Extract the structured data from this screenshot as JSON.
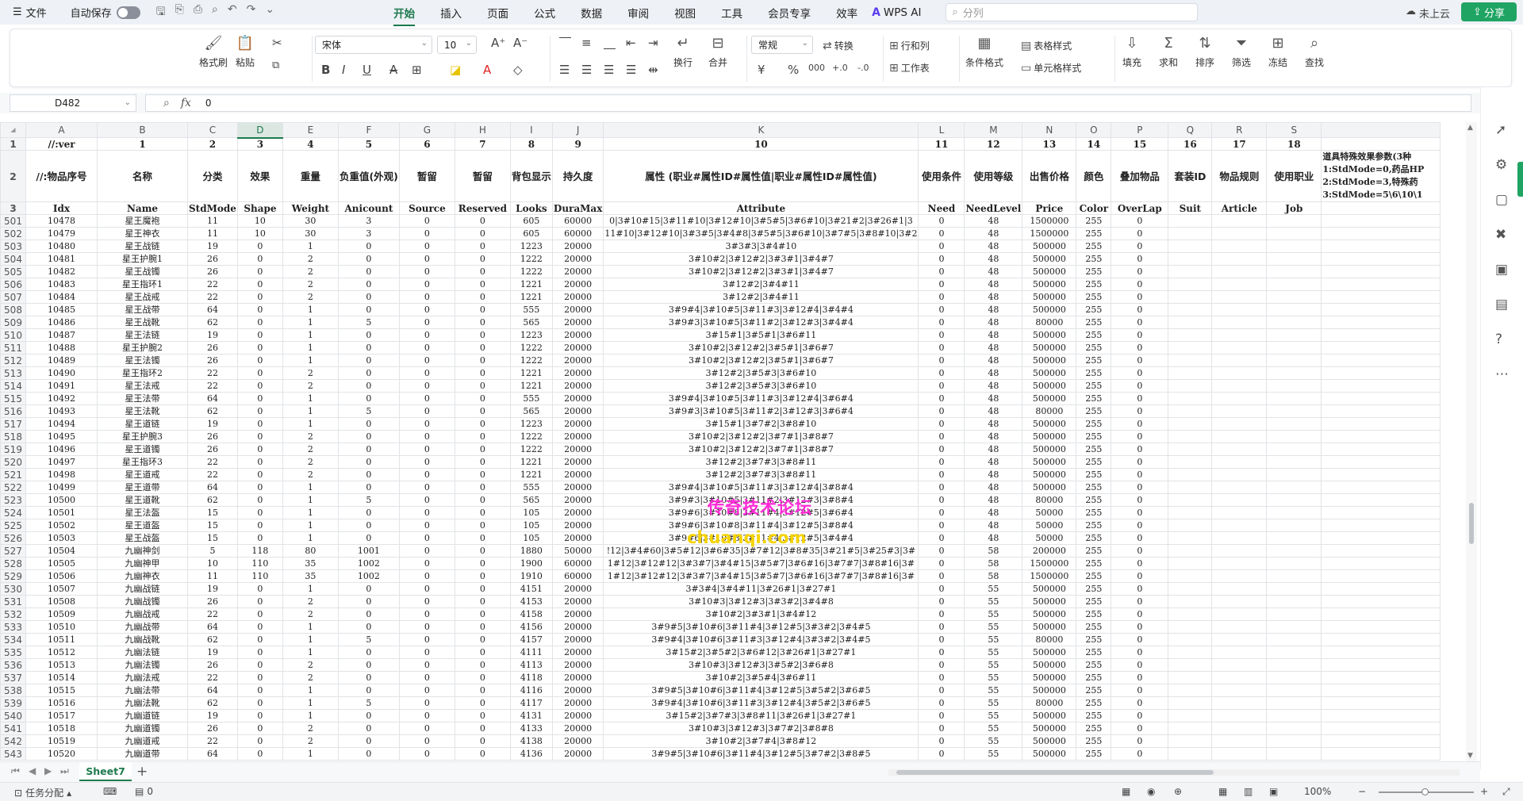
{
  "menu": {
    "file": "文件",
    "autosave": "自动保存",
    "tabs": [
      "开始",
      "插入",
      "页面",
      "公式",
      "数据",
      "审阅",
      "视图",
      "工具",
      "会员专享",
      "效率"
    ],
    "wps_ai": "WPS AI",
    "search_placeholder": "分列",
    "cloud": "未上云",
    "share": "分享"
  },
  "ribbon": {
    "format_painter": "格式刷",
    "paste": "粘贴",
    "font_name": "宋体",
    "font_size": "10",
    "number_format": "常规",
    "convert": "转换",
    "row_col": "行和列",
    "worksheet": "工作表",
    "wrap": "换行",
    "merge": "合并",
    "cond_format": "条件格式",
    "table_style": "表格样式",
    "cell_style": "单元格样式",
    "fill": "填充",
    "sum": "求和",
    "sort": "排序",
    "filter": "筛选",
    "freeze": "冻结",
    "find": "查找"
  },
  "formula_bar": {
    "cell_ref": "D482",
    "fx": "fx",
    "value": "0"
  },
  "columns": [
    "A",
    "B",
    "C",
    "D",
    "E",
    "F",
    "G",
    "H",
    "I",
    "J",
    "K",
    "L",
    "M",
    "N",
    "O",
    "P",
    "Q",
    "R",
    "S"
  ],
  "selected_column": "D",
  "header_row1": {
    "row": "1",
    "cells": [
      "//:ver",
      "1",
      "2",
      "3",
      "4",
      "5",
      "6",
      "7",
      "8",
      "9",
      "10",
      "11",
      "12",
      "13",
      "14",
      "15",
      "16",
      "17",
      "18"
    ]
  },
  "header_row2": {
    "row": "2",
    "cells": [
      "//:物品序号",
      "名称",
      "分类",
      "效果",
      "重量",
      "负重值(外观)",
      "暂留",
      "暂留",
      "背包显示",
      "持久度",
      "属性 (职业#属性ID#属性值|职业#属性ID#属性值)",
      "使用条件",
      "使用等级",
      "出售价格",
      "颜色",
      "叠加物品",
      "套装ID",
      "物品规则",
      "使用职业"
    ]
  },
  "note": "道具特殊效果参数(3种\n1:StdMode=0,药品HP\n2:StdMode=3,特殊药\n3:StdMode=5\\6\\10\\1",
  "header_row3": {
    "row": "3",
    "cells": [
      "Idx",
      "Name",
      "StdMode",
      "Shape",
      "Weight",
      "Anicount",
      "Source",
      "Reserved",
      "Looks",
      "DuraMax",
      "Attribute",
      "Need",
      "NeedLevel",
      "Price",
      "Color",
      "OverLap",
      "Suit",
      "Article",
      "Job"
    ]
  },
  "rows": [
    [
      "501",
      "10478",
      "星王魔袍",
      "11",
      "10",
      "30",
      "3",
      "0",
      "0",
      "605",
      "60000",
      "0|3#10#15|3#11#10|3#12#10|3#5#5|3#6#10|3#21#2|3#26#1|3",
      "0",
      "48",
      "1500000",
      "255",
      "0"
    ],
    [
      "502",
      "10479",
      "星王神衣",
      "11",
      "10",
      "30",
      "3",
      "0",
      "0",
      "605",
      "60000",
      "11#10|3#12#10|3#3#5|3#4#8|3#5#5|3#6#10|3#7#5|3#8#10|3#2",
      "0",
      "48",
      "1500000",
      "255",
      "0"
    ],
    [
      "503",
      "10480",
      "星王战链",
      "19",
      "0",
      "1",
      "0",
      "0",
      "0",
      "1223",
      "20000",
      "3#3#3|3#4#10",
      "0",
      "48",
      "500000",
      "255",
      "0"
    ],
    [
      "504",
      "10481",
      "星王护腕1",
      "26",
      "0",
      "2",
      "0",
      "0",
      "0",
      "1222",
      "20000",
      "3#10#2|3#12#2|3#3#1|3#4#7",
      "0",
      "48",
      "500000",
      "255",
      "0"
    ],
    [
      "505",
      "10482",
      "星王战镯",
      "26",
      "0",
      "2",
      "0",
      "0",
      "0",
      "1222",
      "20000",
      "3#10#2|3#12#2|3#3#1|3#4#7",
      "0",
      "48",
      "500000",
      "255",
      "0"
    ],
    [
      "506",
      "10483",
      "星王指环1",
      "22",
      "0",
      "2",
      "0",
      "0",
      "0",
      "1221",
      "20000",
      "3#12#2|3#4#11",
      "0",
      "48",
      "500000",
      "255",
      "0"
    ],
    [
      "507",
      "10484",
      "星王战戒",
      "22",
      "0",
      "2",
      "0",
      "0",
      "0",
      "1221",
      "20000",
      "3#12#2|3#4#11",
      "0",
      "48",
      "500000",
      "255",
      "0"
    ],
    [
      "508",
      "10485",
      "星王战带",
      "64",
      "0",
      "1",
      "0",
      "0",
      "0",
      "555",
      "20000",
      "3#9#4|3#10#5|3#11#3|3#12#4|3#4#4",
      "0",
      "48",
      "500000",
      "255",
      "0"
    ],
    [
      "509",
      "10486",
      "星王战靴",
      "62",
      "0",
      "1",
      "5",
      "0",
      "0",
      "565",
      "20000",
      "3#9#3|3#10#5|3#11#2|3#12#3|3#4#4",
      "0",
      "48",
      "80000",
      "255",
      "0"
    ],
    [
      "510",
      "10487",
      "星王法链",
      "19",
      "0",
      "1",
      "0",
      "0",
      "0",
      "1223",
      "20000",
      "3#15#1|3#5#1|3#6#11",
      "0",
      "48",
      "500000",
      "255",
      "0"
    ],
    [
      "511",
      "10488",
      "星王护腕2",
      "26",
      "0",
      "1",
      "0",
      "0",
      "0",
      "1222",
      "20000",
      "3#10#2|3#12#2|3#5#1|3#6#7",
      "0",
      "48",
      "500000",
      "255",
      "0"
    ],
    [
      "512",
      "10489",
      "星王法镯",
      "26",
      "0",
      "1",
      "0",
      "0",
      "0",
      "1222",
      "20000",
      "3#10#2|3#12#2|3#5#1|3#6#7",
      "0",
      "48",
      "500000",
      "255",
      "0"
    ],
    [
      "513",
      "10490",
      "星王指环2",
      "22",
      "0",
      "2",
      "0",
      "0",
      "0",
      "1221",
      "20000",
      "3#12#2|3#5#3|3#6#10",
      "0",
      "48",
      "500000",
      "255",
      "0"
    ],
    [
      "514",
      "10491",
      "星王法戒",
      "22",
      "0",
      "2",
      "0",
      "0",
      "0",
      "1221",
      "20000",
      "3#12#2|3#5#3|3#6#10",
      "0",
      "48",
      "500000",
      "255",
      "0"
    ],
    [
      "515",
      "10492",
      "星王法带",
      "64",
      "0",
      "1",
      "0",
      "0",
      "0",
      "555",
      "20000",
      "3#9#4|3#10#5|3#11#3|3#12#4|3#6#4",
      "0",
      "48",
      "500000",
      "255",
      "0"
    ],
    [
      "516",
      "10493",
      "星王法靴",
      "62",
      "0",
      "1",
      "5",
      "0",
      "0",
      "565",
      "20000",
      "3#9#3|3#10#5|3#11#2|3#12#3|3#6#4",
      "0",
      "48",
      "80000",
      "255",
      "0"
    ],
    [
      "517",
      "10494",
      "星王道链",
      "19",
      "0",
      "1",
      "0",
      "0",
      "0",
      "1223",
      "20000",
      "3#15#1|3#7#2|3#8#10",
      "0",
      "48",
      "500000",
      "255",
      "0"
    ],
    [
      "518",
      "10495",
      "星王护腕3",
      "26",
      "0",
      "2",
      "0",
      "0",
      "0",
      "1222",
      "20000",
      "3#10#2|3#12#2|3#7#1|3#8#7",
      "0",
      "48",
      "500000",
      "255",
      "0"
    ],
    [
      "519",
      "10496",
      "星王道镯",
      "26",
      "0",
      "2",
      "0",
      "0",
      "0",
      "1222",
      "20000",
      "3#10#2|3#12#2|3#7#1|3#8#7",
      "0",
      "48",
      "500000",
      "255",
      "0"
    ],
    [
      "520",
      "10497",
      "星王指环3",
      "22",
      "0",
      "2",
      "0",
      "0",
      "0",
      "1221",
      "20000",
      "3#12#2|3#7#3|3#8#11",
      "0",
      "48",
      "500000",
      "255",
      "0"
    ],
    [
      "521",
      "10498",
      "星王道戒",
      "22",
      "0",
      "2",
      "0",
      "0",
      "0",
      "1221",
      "20000",
      "3#12#2|3#7#3|3#8#11",
      "0",
      "48",
      "500000",
      "255",
      "0"
    ],
    [
      "522",
      "10499",
      "星王道带",
      "64",
      "0",
      "1",
      "0",
      "0",
      "0",
      "555",
      "20000",
      "3#9#4|3#10#5|3#11#3|3#12#4|3#8#4",
      "0",
      "48",
      "500000",
      "255",
      "0"
    ],
    [
      "523",
      "10500",
      "星王道靴",
      "62",
      "0",
      "1",
      "5",
      "0",
      "0",
      "565",
      "20000",
      "3#9#3|3#10#5|3#11#2|3#12#3|3#8#4",
      "0",
      "48",
      "80000",
      "255",
      "0"
    ],
    [
      "524",
      "10501",
      "星王法盔",
      "15",
      "0",
      "1",
      "0",
      "0",
      "0",
      "105",
      "20000",
      "3#9#6|3#10#8|3#11#4|3#12#5|3#6#4",
      "0",
      "48",
      "50000",
      "255",
      "0"
    ],
    [
      "525",
      "10502",
      "星王道盔",
      "15",
      "0",
      "1",
      "0",
      "0",
      "0",
      "105",
      "20000",
      "3#9#6|3#10#8|3#11#4|3#12#5|3#8#4",
      "0",
      "48",
      "50000",
      "255",
      "0"
    ],
    [
      "526",
      "10503",
      "星王战盔",
      "15",
      "0",
      "1",
      "0",
      "0",
      "0",
      "105",
      "20000",
      "3#9#6|3#10#8|3#11#4|3#12#5|3#4#4",
      "0",
      "48",
      "50000",
      "255",
      "0"
    ],
    [
      "527",
      "10504",
      "九幽神剑",
      "5",
      "118",
      "80",
      "1001",
      "0",
      "0",
      "1880",
      "50000",
      "!12|3#4#60|3#5#12|3#6#35|3#7#12|3#8#35|3#21#5|3#25#3|3#",
      "0",
      "58",
      "200000",
      "255",
      "0"
    ],
    [
      "528",
      "10505",
      "九幽神甲",
      "10",
      "110",
      "35",
      "1002",
      "0",
      "0",
      "1900",
      "60000",
      "1#12|3#12#12|3#3#7|3#4#15|3#5#7|3#6#16|3#7#7|3#8#16|3#",
      "0",
      "58",
      "1500000",
      "255",
      "0"
    ],
    [
      "529",
      "10506",
      "九幽神衣",
      "11",
      "110",
      "35",
      "1002",
      "0",
      "0",
      "1910",
      "60000",
      "1#12|3#12#12|3#3#7|3#4#15|3#5#7|3#6#16|3#7#7|3#8#16|3#",
      "0",
      "58",
      "1500000",
      "255",
      "0"
    ],
    [
      "530",
      "10507",
      "九幽战链",
      "19",
      "0",
      "1",
      "0",
      "0",
      "0",
      "4151",
      "20000",
      "3#3#4|3#4#11|3#26#1|3#27#1",
      "0",
      "55",
      "500000",
      "255",
      "0"
    ],
    [
      "531",
      "10508",
      "九幽战镯",
      "26",
      "0",
      "2",
      "0",
      "0",
      "0",
      "4153",
      "20000",
      "3#10#3|3#12#3|3#3#2|3#4#8",
      "0",
      "55",
      "500000",
      "255",
      "0"
    ],
    [
      "532",
      "10509",
      "九幽战戒",
      "22",
      "0",
      "2",
      "0",
      "0",
      "0",
      "4158",
      "20000",
      "3#10#2|3#3#1|3#4#12",
      "0",
      "55",
      "500000",
      "255",
      "0"
    ],
    [
      "533",
      "10510",
      "九幽战带",
      "64",
      "0",
      "1",
      "0",
      "0",
      "0",
      "4156",
      "20000",
      "3#9#5|3#10#6|3#11#4|3#12#5|3#3#2|3#4#5",
      "0",
      "55",
      "500000",
      "255",
      "0"
    ],
    [
      "534",
      "10511",
      "九幽战靴",
      "62",
      "0",
      "1",
      "5",
      "0",
      "0",
      "4157",
      "20000",
      "3#9#4|3#10#6|3#11#3|3#12#4|3#3#2|3#4#5",
      "0",
      "55",
      "80000",
      "255",
      "0"
    ],
    [
      "535",
      "10512",
      "九幽法链",
      "19",
      "0",
      "1",
      "0",
      "0",
      "0",
      "4111",
      "20000",
      "3#15#2|3#5#2|3#6#12|3#26#1|3#27#1",
      "0",
      "55",
      "500000",
      "255",
      "0"
    ],
    [
      "536",
      "10513",
      "九幽法镯",
      "26",
      "0",
      "2",
      "0",
      "0",
      "0",
      "4113",
      "20000",
      "3#10#3|3#12#3|3#5#2|3#6#8",
      "0",
      "55",
      "500000",
      "255",
      "0"
    ],
    [
      "537",
      "10514",
      "九幽法戒",
      "22",
      "0",
      "2",
      "0",
      "0",
      "0",
      "4118",
      "20000",
      "3#10#2|3#5#4|3#6#11",
      "0",
      "55",
      "500000",
      "255",
      "0"
    ],
    [
      "538",
      "10515",
      "九幽法带",
      "64",
      "0",
      "1",
      "0",
      "0",
      "0",
      "4116",
      "20000",
      "3#9#5|3#10#6|3#11#4|3#12#5|3#5#2|3#6#5",
      "0",
      "55",
      "500000",
      "255",
      "0"
    ],
    [
      "539",
      "10516",
      "九幽法靴",
      "62",
      "0",
      "1",
      "5",
      "0",
      "0",
      "4117",
      "20000",
      "3#9#4|3#10#6|3#11#3|3#12#4|3#5#2|3#6#5",
      "0",
      "55",
      "80000",
      "255",
      "0"
    ],
    [
      "540",
      "10517",
      "九幽道链",
      "19",
      "0",
      "1",
      "0",
      "0",
      "0",
      "4131",
      "20000",
      "3#15#2|3#7#3|3#8#11|3#26#1|3#27#1",
      "0",
      "55",
      "500000",
      "255",
      "0"
    ],
    [
      "541",
      "10518",
      "九幽道镯",
      "26",
      "0",
      "2",
      "0",
      "0",
      "0",
      "4133",
      "20000",
      "3#10#3|3#12#3|3#7#2|3#8#8",
      "0",
      "55",
      "500000",
      "255",
      "0"
    ],
    [
      "542",
      "10519",
      "九幽道戒",
      "22",
      "0",
      "2",
      "0",
      "0",
      "0",
      "4138",
      "20000",
      "3#10#2|3#7#4|3#8#12",
      "0",
      "55",
      "500000",
      "255",
      "0"
    ],
    [
      "543",
      "10520",
      "九幽道带",
      "64",
      "0",
      "1",
      "0",
      "0",
      "0",
      "4136",
      "20000",
      "3#9#5|3#10#6|3#11#4|3#12#5|3#7#2|3#8#5",
      "0",
      "55",
      "500000",
      "255",
      "0"
    ]
  ],
  "watermark": {
    "line1": "传奇技术论坛",
    "line2": "chuanqi.com"
  },
  "sheet_tab": "Sheet7",
  "status": {
    "task": "任务分配",
    "count": "0",
    "zoom": "100%"
  },
  "accent_color": "#1d7a4d"
}
